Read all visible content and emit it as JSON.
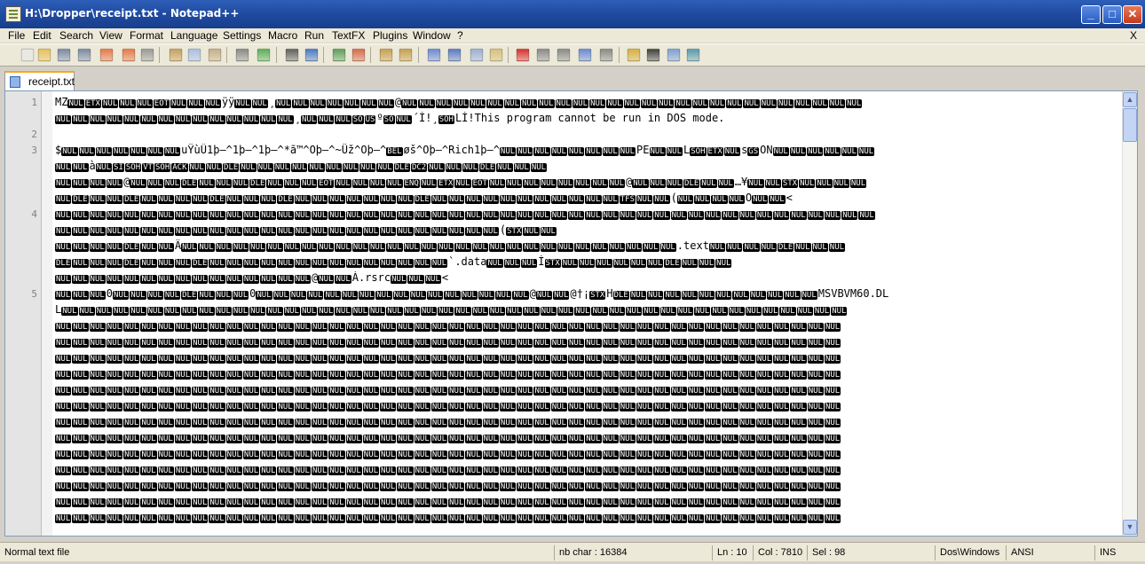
{
  "window": {
    "title": "H:\\Dropper\\receipt.txt - Notepad++",
    "minimize": "_",
    "maximize": "□",
    "close": "✕"
  },
  "menu": [
    {
      "label": "File",
      "accel": "F",
      "rest": "ile"
    },
    {
      "label": "Edit",
      "accel": "E",
      "rest": "dit"
    },
    {
      "label": "Search",
      "accel": "S",
      "rest": "earch"
    },
    {
      "label": "View",
      "accel": "V",
      "rest": "iew"
    },
    {
      "label": "Format",
      "accel": "o",
      "pre": "F",
      "rest": "rmat"
    },
    {
      "label": "Language",
      "accel": "L",
      "rest": "anguage"
    },
    {
      "label": "Settings",
      "accel": "t",
      "pre": "Se",
      "rest": "tings"
    },
    {
      "label": "Macro",
      "accel": "M",
      "rest": "acro"
    },
    {
      "label": "Run",
      "accel": "R",
      "rest": "un"
    },
    {
      "label": "TextFX",
      "accel": "",
      "rest": "TextFX"
    },
    {
      "label": "Plugins",
      "accel": "P",
      "rest": "lugins"
    },
    {
      "label": "Window",
      "accel": "W",
      "rest": "indow"
    },
    {
      "label": "?",
      "accel": "?",
      "rest": ""
    }
  ],
  "menu_close": "X",
  "toolbar_icons": [
    "new-icon",
    "open-icon",
    "save-icon",
    "save-all-icon",
    "close-icon",
    "close-all-icon",
    "print-icon",
    "cut-icon",
    "copy-icon",
    "paste-icon",
    "undo-icon",
    "redo-icon",
    "find-icon",
    "replace-icon",
    "zoom-in-icon",
    "zoom-out-icon",
    "sync-v-icon",
    "sync-h-icon",
    "wrap-icon",
    "all-chars-icon",
    "indent-guide-icon",
    "doc-map-icon",
    "record-icon",
    "stop-icon",
    "play-icon",
    "play-multi-icon",
    "save-macro-icon",
    "spell-icon",
    "heading-icon",
    "console-icon",
    "abc-icon"
  ],
  "tab": {
    "label": "receipt.txt"
  },
  "editor": {
    "lines": [
      {
        "num": "1",
        "text": "MZ NUL ETX NUL NUL NUL EOT NUL NUL NUL ÿÿ NUL NUL ¸ NUL NUL NUL NUL NUL NUL NUL @ NUL NUL NUL NUL NUL NUL NUL NUL NUL NUL NUL NUL NUL NUL NUL NUL NUL NUL NUL NUL NUL NUL NUL NUL NUL NUL NUL"
      },
      {
        "num": "",
        "text": "NUL NUL NUL NUL NUL NUL NUL NUL NUL NUL NUL NUL NUL NUL ¸ NUL NUL NUL SO US º SO NUL ´  Í!¸ SOH LÍ!This program cannot be run in DOS mode."
      },
      {
        "num": "2",
        "text": ""
      },
      {
        "num": "3",
        "text": "$ NUL NUL NUL NUL NUL NUL NUL uŸùÛ1þ—^1þ—^1þ—^*ã™^Oþ—^~Üž^Oþ—^ BEL øš^Oþ—^Rich1þ—^ NUL NUL NUL NUL NUL NUL NUL NUL PE NUL NUL L SOH ETX NUL s GS ON NUL NUL NUL NUL NUL NUL"
      },
      {
        "num": "",
        "text": "NUL NUL à NUL SI SOH VT SOH ACK NUL NUL DLE NUL NUL NUL  NUL NUL NUL NUL NUL NUL DLE DC2 NUL NUL NUL DLE NUL NUL NUL"
      },
      {
        "num": "",
        "text": "NUL NUL NUL NUL @ NUL NUL NUL DLE NUL NUL NUL DLE NUL NUL NUL EOT NUL NUL NUL NUL ENQ NUL ETX NUL EOT NUL NUL NUL NUL NUL NUL NUL NUL @ NUL NUL NUL DLE NUL NUL …¥ NUL NUL STX NUL NUL NUL NUL"
      },
      {
        "num": "",
        "text": "NUL DLE NUL NUL DLE NUL NUL NUL NUL DLE NUL NUL NUL DLE NUL NUL NUL NUL NUL NUL NUL DLE NUL NUL NUL NUL NUL NUL NUL NUL NUL NUL NUL TFS NUL NUL ( NUL NUL NUL NUL O NUL NUL <"
      },
      {
        "num": "4",
        "text": "NUL NUL NUL NUL NUL NUL NUL NUL NUL NUL NUL NUL NUL NUL NUL NUL NUL NUL NUL NUL NUL NUL NUL NUL NUL NUL NUL NUL NUL NUL NUL NUL NUL NUL NUL NUL NUL NUL NUL NUL NUL NUL NUL NUL NUL NUL NUL NUL"
      },
      {
        "num": "",
        "text": "NUL NUL NUL NUL NUL NUL NUL NUL NUL NUL NUL NUL NUL NUL NUL NUL NUL NUL NUL NUL NUL NUL NUL NUL NUL NUL ( STX NUL NUL"
      },
      {
        "num": "",
        "text": "NUL NUL NUL NUL DLE NUL NUL Ä NUL NUL NUL NUL NUL NUL NUL NUL NUL NUL NUL NUL NUL NUL NUL NUL NUL NUL NUL NUL NUL NUL NUL NUL NUL NUL NUL NUL NUL .text NUL NUL NUL NUL DLE NUL NUL NUL"
      },
      {
        "num": "",
        "text": "DLE NUL NUL NUL DLE NUL NUL NUL DLE NUL NUL NUL NUL NUL NUL NUL NUL NUL NUL NUL NUL  NUL NUL `.data NUL NUL NUL ÌSTX NUL NUL NUL  NUL NUL NUL DLE NUL NUL NUL"
      },
      {
        "num": "",
        "text": "NUL NUL NUL NUL NUL NUL NUL NUL NUL NUL NUL NUL NUL NUL NUL @ NUL NUL À.rsrc NUL NUL NUL <"
      },
      {
        "num": "5",
        "text": "NUL NUL NUL 0 NUL NUL NUL NUL DLE NUL NUL NUL 0 NUL NUL NUL NUL NUL NUL NUL NUL NUL NUL NUL NUL NUL NUL NUL NUL @ NUL NUL @†¡ STX H DLE NUL NUL NUL NUL NUL NUL NUL NUL NUL NUL NUL MSVBVM60.DL"
      },
      {
        "num": "",
        "text": "L NUL NUL NUL NUL NUL NUL NUL NUL NUL NUL NUL NUL NUL NUL NUL NUL NUL NUL NUL NUL NUL NUL NUL NUL NUL NUL NUL NUL NUL NUL NUL NUL NUL NUL NUL NUL NUL NUL NUL NUL NUL NUL NUL NUL NUL NUL"
      },
      {
        "num": "",
        "text": "NUL NUL NUL NUL NUL NUL NUL NUL NUL NUL NUL NUL NUL NUL NUL NUL NUL NUL NUL NUL NUL NUL NUL NUL NUL NUL NUL NUL NUL NUL NUL NUL NUL NUL NUL NUL NUL NUL NUL NUL NUL NUL NUL NUL NUL NUL"
      },
      {
        "num": "",
        "text": "NUL NUL NUL NUL NUL NUL NUL NUL NUL NUL NUL NUL NUL NUL NUL NUL NUL NUL NUL NUL NUL NUL NUL NUL NUL NUL NUL NUL NUL NUL NUL NUL NUL NUL NUL NUL NUL NUL NUL NUL NUL NUL NUL NUL NUL NUL"
      },
      {
        "num": "",
        "text": "NUL NUL NUL NUL NUL NUL NUL NUL NUL NUL NUL NUL NUL NUL NUL NUL NUL NUL NUL NUL NUL NUL NUL NUL NUL NUL NUL NUL NUL NUL NUL NUL NUL NUL NUL NUL NUL NUL NUL NUL NUL NUL NUL NUL NUL NUL"
      },
      {
        "num": "",
        "text": "NUL NUL NUL NUL NUL NUL NUL NUL NUL NUL NUL NUL NUL NUL NUL NUL NUL NUL NUL NUL NUL NUL NUL NUL NUL NUL NUL NUL NUL NUL NUL NUL NUL NUL NUL NUL NUL NUL NUL NUL NUL NUL NUL NUL NUL NUL"
      },
      {
        "num": "",
        "text": "NUL NUL NUL NUL NUL NUL NUL NUL NUL NUL NUL NUL NUL NUL NUL NUL NUL NUL NUL NUL NUL NUL NUL NUL NUL NUL NUL NUL NUL NUL NUL NUL NUL NUL NUL NUL NUL NUL NUL NUL NUL NUL NUL NUL NUL NUL"
      },
      {
        "num": "",
        "text": "NUL NUL NUL NUL NUL NUL NUL NUL NUL NUL NUL NUL NUL NUL NUL NUL NUL NUL NUL NUL NUL NUL NUL NUL NUL NUL NUL NUL NUL NUL NUL NUL NUL NUL NUL NUL NUL NUL NUL NUL NUL NUL NUL NUL NUL NUL"
      },
      {
        "num": "",
        "text": "NUL NUL NUL NUL NUL NUL NUL NUL NUL NUL NUL NUL NUL NUL NUL NUL NUL NUL NUL NUL NUL NUL NUL NUL NUL NUL NUL NUL NUL NUL NUL NUL NUL NUL NUL NUL NUL NUL NUL NUL NUL NUL NUL NUL NUL NUL"
      },
      {
        "num": "",
        "text": "NUL NUL NUL NUL NUL NUL NUL NUL NUL NUL NUL NUL NUL NUL NUL NUL NUL NUL NUL NUL NUL NUL NUL NUL NUL NUL NUL NUL NUL NUL NUL NUL NUL NUL NUL NUL NUL NUL NUL NUL NUL NUL NUL NUL NUL NUL"
      },
      {
        "num": "",
        "text": "NUL NUL NUL NUL NUL NUL NUL NUL NUL NUL NUL NUL NUL NUL NUL NUL NUL NUL NUL NUL NUL NUL NUL NUL NUL NUL NUL NUL NUL NUL NUL NUL NUL NUL NUL NUL NUL NUL NUL NUL NUL NUL NUL NUL NUL NUL"
      },
      {
        "num": "",
        "text": "NUL NUL NUL NUL NUL NUL NUL NUL NUL NUL NUL NUL NUL NUL NUL NUL NUL NUL NUL NUL NUL NUL NUL NUL NUL NUL NUL NUL NUL NUL NUL NUL NUL NUL NUL NUL NUL NUL NUL NUL NUL NUL NUL NUL NUL NUL"
      },
      {
        "num": "",
        "text": "NUL NUL NUL NUL NUL NUL NUL NUL NUL NUL NUL NUL NUL NUL NUL NUL NUL NUL NUL NUL NUL NUL NUL NUL NUL NUL NUL NUL NUL NUL NUL NUL NUL NUL NUL NUL NUL NUL NUL NUL NUL NUL NUL NUL NUL NUL"
      },
      {
        "num": "",
        "text": "NUL NUL NUL NUL NUL NUL NUL NUL NUL NUL NUL NUL NUL NUL NUL NUL NUL NUL NUL NUL NUL NUL NUL NUL NUL NUL NUL NUL NUL NUL NUL NUL NUL NUL NUL NUL NUL NUL NUL NUL NUL NUL NUL NUL NUL NUL"
      },
      {
        "num": "",
        "text": "NUL NUL NUL NUL NUL NUL NUL NUL NUL NUL NUL NUL NUL NUL NUL NUL NUL NUL NUL NUL NUL NUL NUL NUL NUL NUL NUL NUL NUL NUL NUL NUL NUL NUL NUL NUL NUL NUL NUL NUL NUL NUL NUL NUL NUL NUL"
      }
    ]
  },
  "status": {
    "file_type": "Normal text file",
    "nb_char": "nb char : 16384",
    "ln": "Ln : 10",
    "col": "Col : 7810",
    "sel": "Sel : 98",
    "eol": "Dos\\Windows",
    "encoding": "ANSI",
    "mode": "INS"
  }
}
